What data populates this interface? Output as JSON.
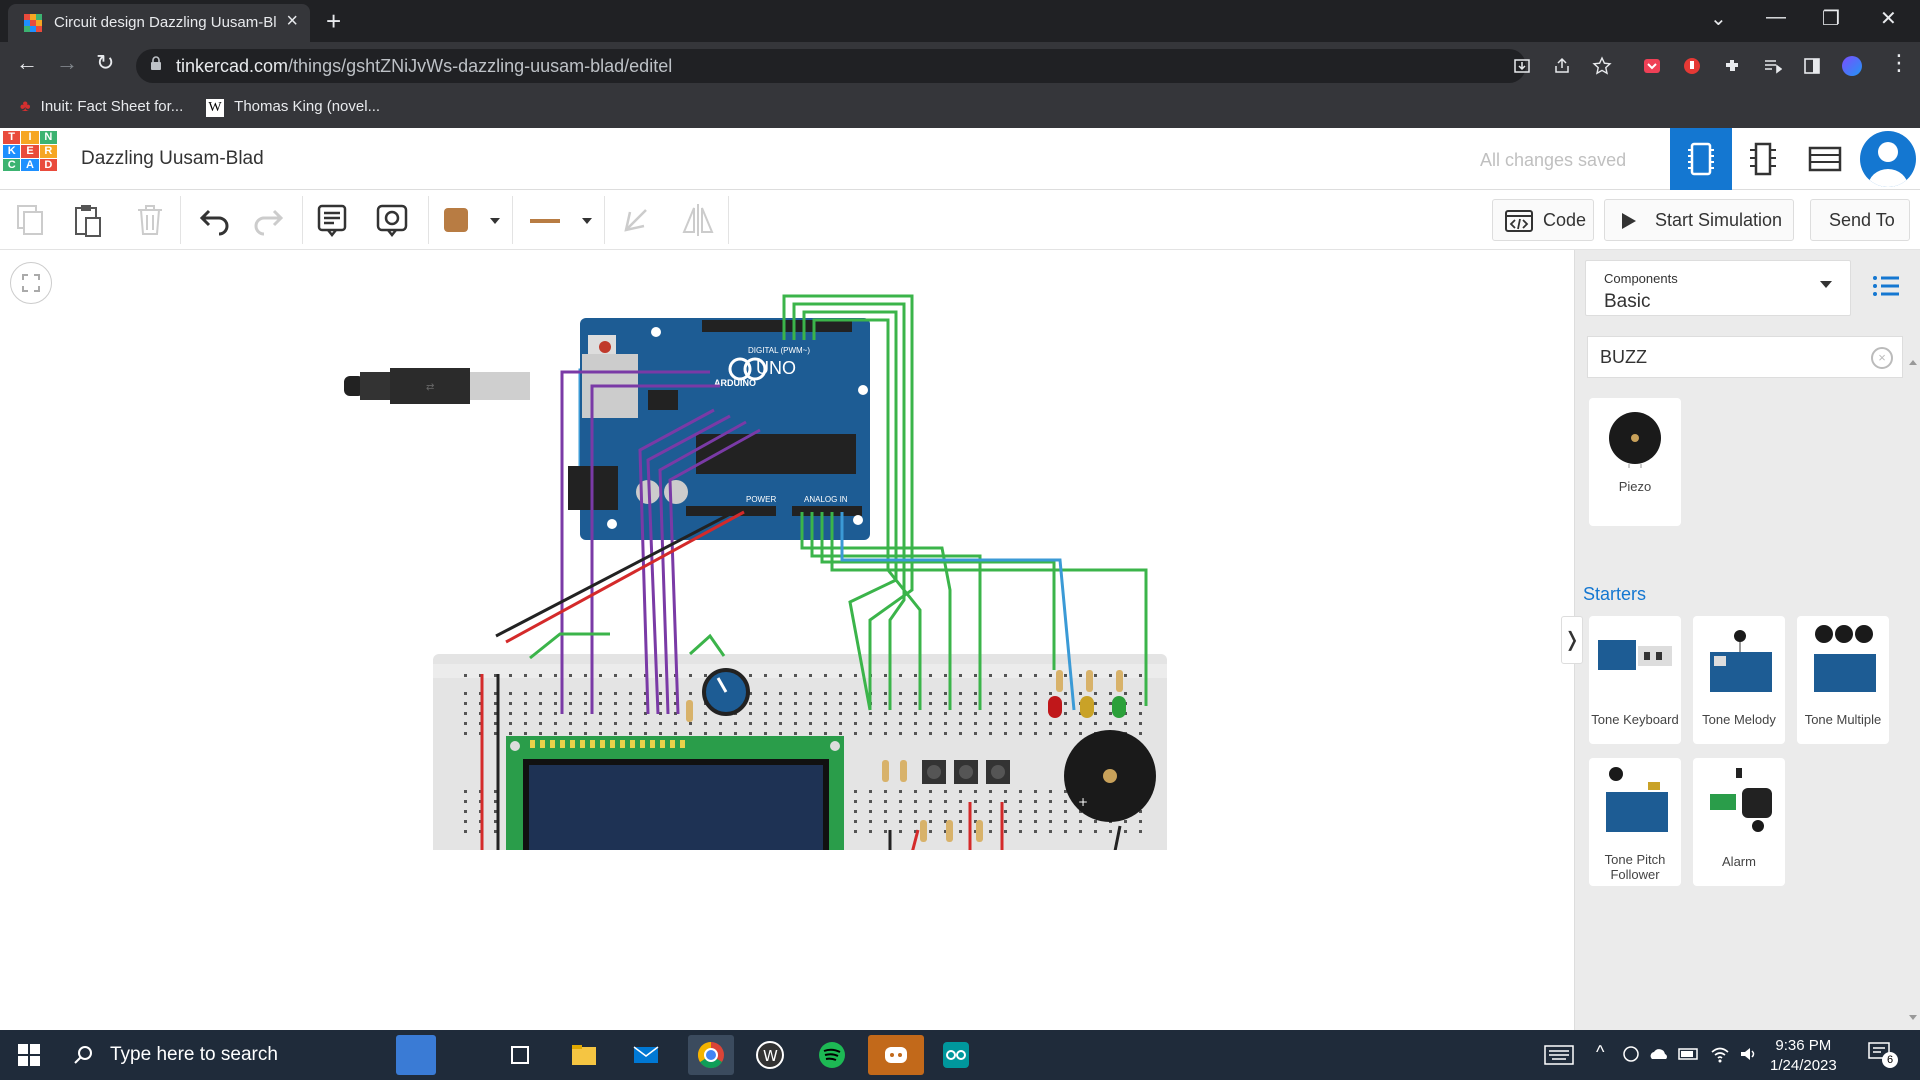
{
  "browser": {
    "tab_title": "Circuit design Dazzling Uusam-Bl",
    "url_host": "tinkercad.com",
    "url_path": "/things/gshtZNiJvWs-dazzling-uusam-blad/editel",
    "bookmarks": [
      {
        "label": "Inuit: Fact Sheet for...",
        "icon": "maple-leaf-icon"
      },
      {
        "label": "Thomas King (novel...",
        "icon": "wikipedia-icon"
      }
    ]
  },
  "header": {
    "logo_letters": [
      "T",
      "I",
      "N",
      "K",
      "E",
      "R",
      "C",
      "A",
      "D"
    ],
    "doc_title": "Dazzling Uusam-Blad",
    "save_status": "All changes saved"
  },
  "toolbar": {
    "code_label": "Code",
    "simulate_label": "Start Simulation",
    "send_label": "Send To",
    "fill_color": "#b87c43"
  },
  "panel": {
    "components_label": "Components",
    "components_value": "Basic",
    "search_value": "BUZZ",
    "results": [
      {
        "label": "Piezo"
      }
    ],
    "starters_title": "Starters",
    "starters": [
      {
        "label": "Tone Keyboard"
      },
      {
        "label": "Tone Melody"
      },
      {
        "label": "Tone Multiple"
      },
      {
        "label": "Tone Pitch Follower"
      },
      {
        "label": "Alarm"
      }
    ]
  },
  "circuit": {
    "board_text": {
      "uno": "UNO",
      "arduino": "ARDUINO",
      "digital": "DIGITAL (PWM~)",
      "power": "POWER",
      "analog": "ANALOG IN"
    },
    "colors": {
      "board": "#1d5c94",
      "breadboard": "#e4e4e4",
      "lcd": "#2a9d4a",
      "wire_green": "#3bb44a",
      "wire_purple": "#7a3aa6",
      "wire_blue": "#3b9ad6",
      "wire_red": "#d42a2a"
    }
  },
  "taskbar": {
    "search_placeholder": "Type here to search",
    "time": "9:36 PM",
    "date": "1/24/2023",
    "notifications": "6"
  }
}
